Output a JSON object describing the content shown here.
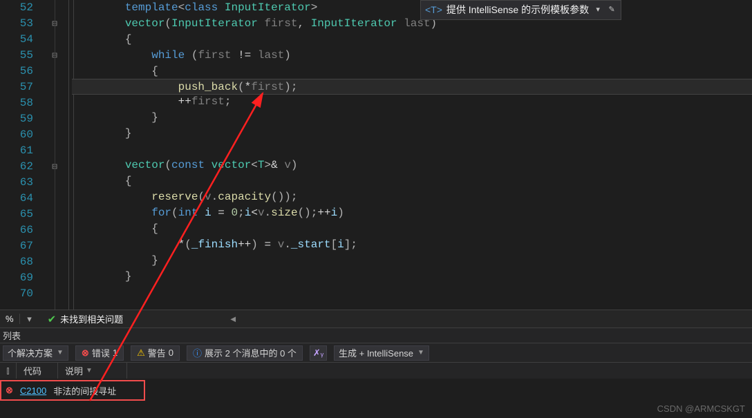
{
  "lines": {
    "52": "52",
    "53": "53",
    "54": "54",
    "55": "55",
    "56": "56",
    "57": "57",
    "58": "58",
    "59": "59",
    "60": "60",
    "61": "61",
    "62": "62",
    "63": "63",
    "64": "64",
    "65": "65",
    "66": "66",
    "67": "67",
    "68": "68",
    "69": "69",
    "70": "70"
  },
  "code": {
    "template_kw": "template",
    "class_kw": "class",
    "InputIterator": "InputIterator",
    "vector": "vector",
    "first": "first",
    "last": "last",
    "while_kw": "while",
    "neq": "!=",
    "push_back": "push_back",
    "deref": "*",
    "inc": "++",
    "const_kw": "const",
    "T": "T",
    "amp": "&",
    "v": "v",
    "reserve": "reserve",
    "capacity": "capacity",
    "for_kw": "for",
    "int_kw": "int",
    "i": "i",
    "zero": "0",
    "size": "size",
    "_finish": "_finish",
    "_start": "_start",
    "lbrace": "{",
    "rbrace": "}",
    "lparen": "(",
    "rparen": ")",
    "lbracket": "[",
    "rbracket": "]",
    "lt": "<",
    "gt": ">",
    "semi": ";",
    "comma": ",",
    "dot": ".",
    "eq": "=",
    "space": " "
  },
  "intellisense": {
    "template": "<T>",
    "text": "提供 IntelliSense 的示例模板参数"
  },
  "status": {
    "pct": "%",
    "no_issues": "未找到相关问题"
  },
  "panel": {
    "list_label": "列表"
  },
  "filter": {
    "solution": "个解决方案",
    "error_label": "错误",
    "error_count": "1",
    "warn_label": "警告",
    "warn_count": "0",
    "messages": "展示 2 个消息中的 0 个",
    "build_mode": "生成 + IntelliSense"
  },
  "cols": {
    "code": "代码",
    "desc": "说明"
  },
  "error": {
    "code": "C2100",
    "desc": "非法的间接寻址"
  },
  "watermark": "CSDN @ARMCSKGT"
}
